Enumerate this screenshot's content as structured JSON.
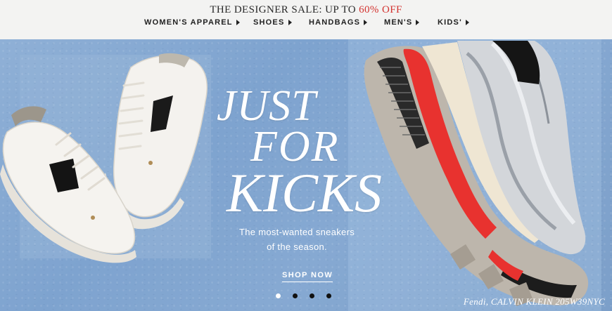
{
  "promo": {
    "prefix": "THE DESIGNER SALE: UP TO ",
    "accent": "60% OFF",
    "accent_color": "#d3322f"
  },
  "nav": {
    "items": [
      {
        "label": "WOMEN'S APPAREL"
      },
      {
        "label": "SHOES"
      },
      {
        "label": "HANDBAGS"
      },
      {
        "label": "MEN'S"
      },
      {
        "label": "KIDS'"
      }
    ]
  },
  "hero": {
    "headline_lines": [
      "JUST",
      "FOR",
      "KICKS"
    ],
    "subhead_lines": [
      "The most-wanted sneakers",
      "of the season."
    ],
    "cta_label": "SHOP NOW",
    "caption": "Fendi, CALVIN KLEIN 205W39NYC",
    "carousel": {
      "count": 4,
      "active": 1
    }
  },
  "icons": {
    "nav_caret": "caret-right-icon"
  }
}
